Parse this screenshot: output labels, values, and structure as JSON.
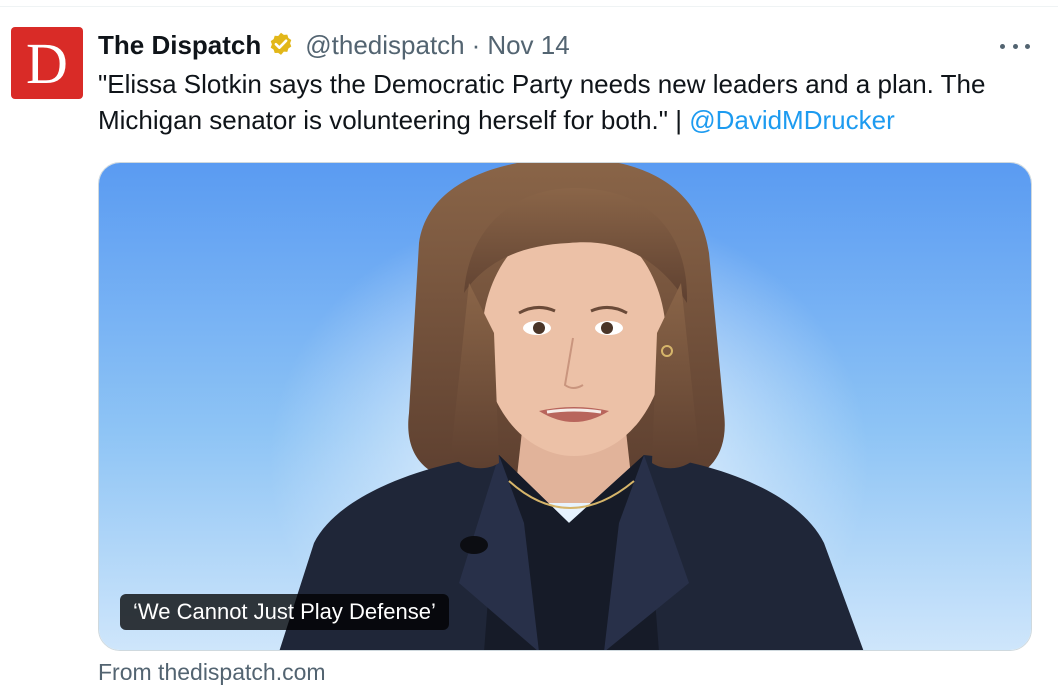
{
  "author": {
    "avatar_letter": "D",
    "display_name": "The Dispatch",
    "verified_icon": "verified-badge-gold",
    "handle": "@thedispatch",
    "separator": "·",
    "date": "Nov 14"
  },
  "more_icon": "more-horizontal-icon",
  "tweet": {
    "text": "\"Elissa Slotkin says the Democratic Party needs new leaders and a plan. The Michigan senator is volunteering herself for both.\" | ",
    "mention": "@DavidMDrucker"
  },
  "media": {
    "caption": "‘We Cannot Just Play Defense’"
  },
  "card": {
    "source": "From thedispatch.com"
  },
  "colors": {
    "brand_red": "#d92b27",
    "link_blue": "#1d9bf0",
    "muted": "#536471",
    "verified_gold": "#e2b719"
  }
}
